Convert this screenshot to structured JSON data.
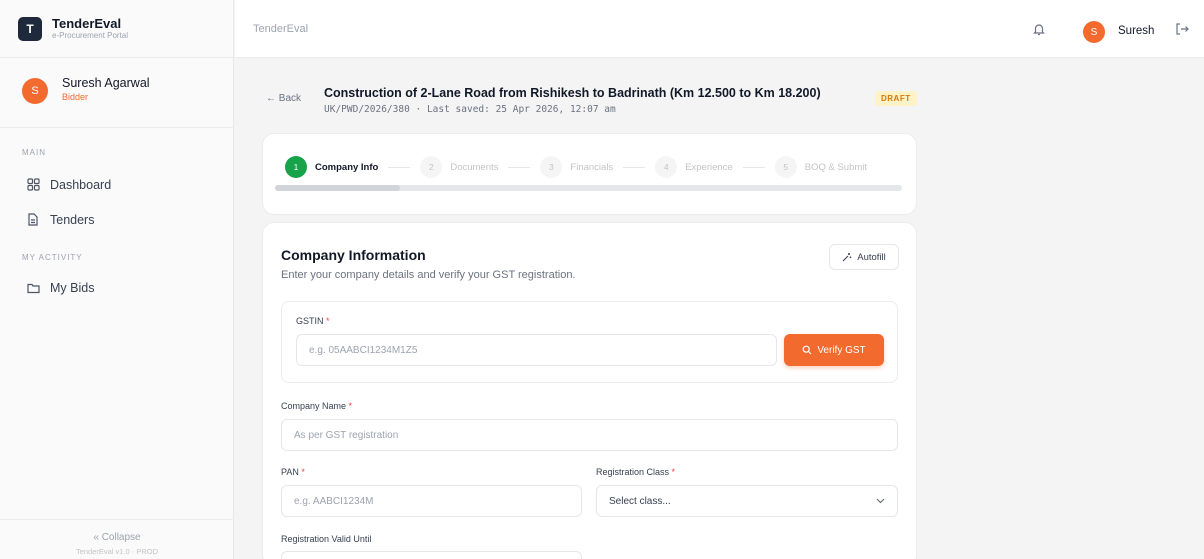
{
  "brand": {
    "logo_letter": "T",
    "name": "TenderEval",
    "subtitle": "e-Procurement Portal"
  },
  "user": {
    "initial": "S",
    "name": "Suresh Agarwal",
    "role": "Bidder"
  },
  "sidebar": {
    "section_main": "MAIN",
    "items_main": [
      {
        "label": "Dashboard",
        "icon": "grid-icon"
      },
      {
        "label": "Tenders",
        "icon": "document-icon"
      }
    ],
    "section_activity": "MY ACTIVITY",
    "items_activity": [
      {
        "label": "My Bids",
        "icon": "folder-icon"
      }
    ],
    "collapse_label": "« Collapse",
    "version": "TenderEval v1.0 · PROD"
  },
  "topbar": {
    "title": "TenderEval",
    "user_initial": "S",
    "user_name": "Suresh"
  },
  "header": {
    "back_label": "← Back",
    "tender_title": "Construction of 2-Lane Road from Rishikesh to Badrinath (Km 12.500 to Km 18.200)",
    "tender_meta": "UK/PWD/2026/380 · Last saved: 25 Apr 2026, 12:07 am",
    "status": "DRAFT"
  },
  "stepper": {
    "steps": [
      {
        "num": "1",
        "label": "Company Info"
      },
      {
        "num": "2",
        "label": "Documents"
      },
      {
        "num": "3",
        "label": "Financials"
      },
      {
        "num": "4",
        "label": "Experience"
      },
      {
        "num": "5",
        "label": "BOQ & Submit"
      }
    ],
    "progress": 0.2
  },
  "form": {
    "title": "Company Information",
    "subtitle": "Enter your company details and verify your GST registration.",
    "autofill_label": "Autofill",
    "gstin_label": "GSTIN",
    "gstin_placeholder": "e.g. 05AABCI1234M1Z5",
    "verify_label": "Verify GST",
    "company_name_label": "Company Name",
    "company_name_placeholder": "As per GST registration",
    "pan_label": "PAN",
    "pan_placeholder": "e.g. AABCI1234M",
    "reg_class_label": "Registration Class",
    "reg_class_value": "Select class...",
    "reg_valid_label": "Registration Valid Until",
    "required_mark": "*"
  },
  "colors": {
    "accent": "#f26a2e",
    "success": "#16a34a",
    "draft": "#d97706"
  }
}
